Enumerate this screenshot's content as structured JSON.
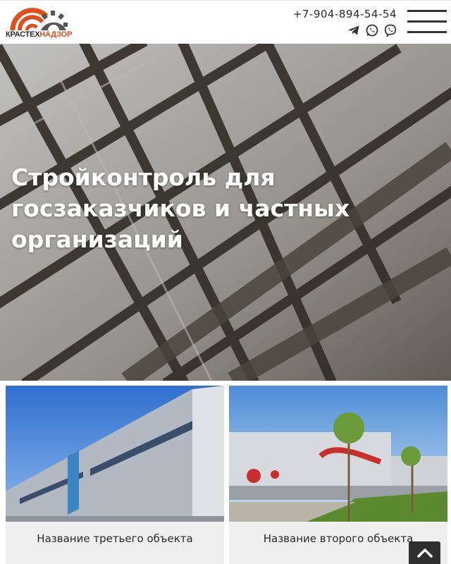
{
  "header": {
    "logo": {
      "part1": "КРАСТЕХ",
      "part2": "НАДЗОР"
    },
    "phone": "+7-904-894-54-54",
    "messengers": [
      {
        "icon": "telegram-icon"
      },
      {
        "icon": "whatsapp-icon"
      },
      {
        "icon": "viber-icon"
      }
    ],
    "menu_icon": "hamburger-menu-icon"
  },
  "hero": {
    "title": "Стройконтроль для госзаказчиков и частных организаций"
  },
  "gallery": {
    "cards": [
      {
        "caption": "Название третьего объекта"
      },
      {
        "caption": "Название второго объекта"
      }
    ]
  },
  "colors": {
    "brand_orange": "#e24e1b",
    "text_dark": "#2a2a2a",
    "card_bg": "#efefef",
    "scroll_button": "#2f2f2f"
  },
  "scroll_top_icon": "chevron-up-icon"
}
